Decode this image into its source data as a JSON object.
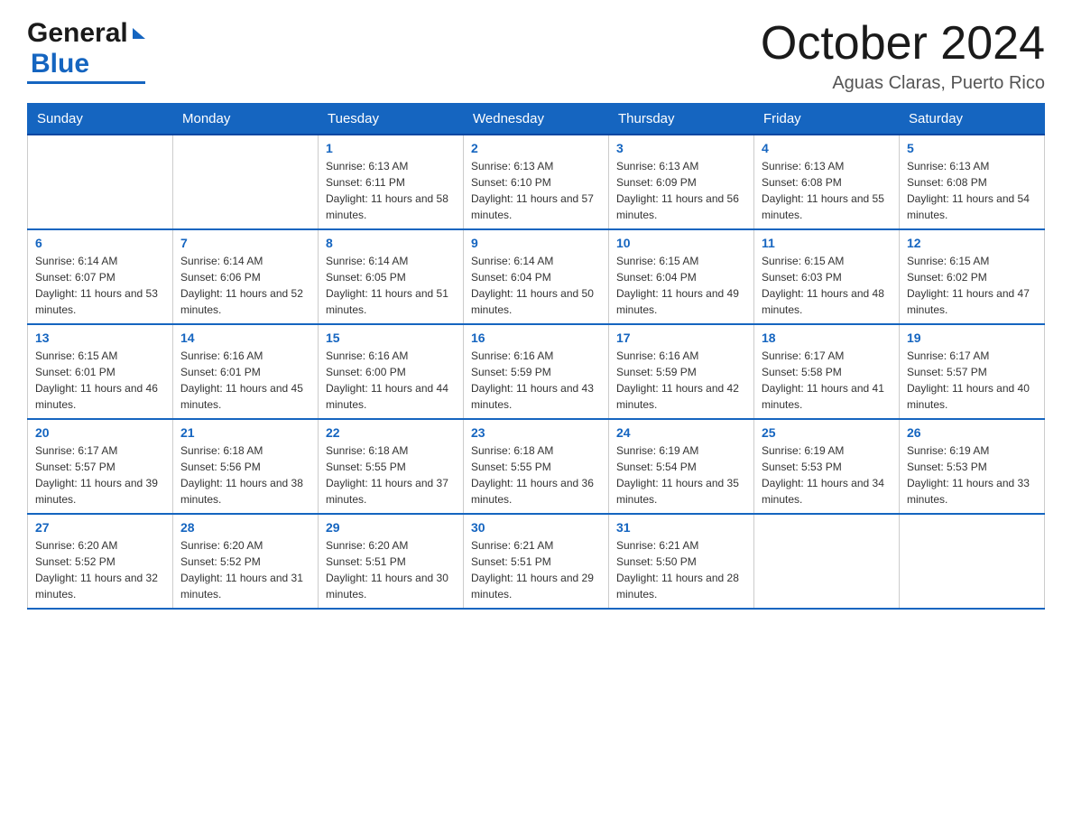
{
  "header": {
    "logo_general": "General",
    "logo_blue": "Blue",
    "month_title": "October 2024",
    "location": "Aguas Claras, Puerto Rico"
  },
  "days_of_week": [
    "Sunday",
    "Monday",
    "Tuesday",
    "Wednesday",
    "Thursday",
    "Friday",
    "Saturday"
  ],
  "weeks": [
    [
      {
        "day": "",
        "sunrise": "",
        "sunset": "",
        "daylight": ""
      },
      {
        "day": "",
        "sunrise": "",
        "sunset": "",
        "daylight": ""
      },
      {
        "day": "1",
        "sunrise": "Sunrise: 6:13 AM",
        "sunset": "Sunset: 6:11 PM",
        "daylight": "Daylight: 11 hours and 58 minutes."
      },
      {
        "day": "2",
        "sunrise": "Sunrise: 6:13 AM",
        "sunset": "Sunset: 6:10 PM",
        "daylight": "Daylight: 11 hours and 57 minutes."
      },
      {
        "day": "3",
        "sunrise": "Sunrise: 6:13 AM",
        "sunset": "Sunset: 6:09 PM",
        "daylight": "Daylight: 11 hours and 56 minutes."
      },
      {
        "day": "4",
        "sunrise": "Sunrise: 6:13 AM",
        "sunset": "Sunset: 6:08 PM",
        "daylight": "Daylight: 11 hours and 55 minutes."
      },
      {
        "day": "5",
        "sunrise": "Sunrise: 6:13 AM",
        "sunset": "Sunset: 6:08 PM",
        "daylight": "Daylight: 11 hours and 54 minutes."
      }
    ],
    [
      {
        "day": "6",
        "sunrise": "Sunrise: 6:14 AM",
        "sunset": "Sunset: 6:07 PM",
        "daylight": "Daylight: 11 hours and 53 minutes."
      },
      {
        "day": "7",
        "sunrise": "Sunrise: 6:14 AM",
        "sunset": "Sunset: 6:06 PM",
        "daylight": "Daylight: 11 hours and 52 minutes."
      },
      {
        "day": "8",
        "sunrise": "Sunrise: 6:14 AM",
        "sunset": "Sunset: 6:05 PM",
        "daylight": "Daylight: 11 hours and 51 minutes."
      },
      {
        "day": "9",
        "sunrise": "Sunrise: 6:14 AM",
        "sunset": "Sunset: 6:04 PM",
        "daylight": "Daylight: 11 hours and 50 minutes."
      },
      {
        "day": "10",
        "sunrise": "Sunrise: 6:15 AM",
        "sunset": "Sunset: 6:04 PM",
        "daylight": "Daylight: 11 hours and 49 minutes."
      },
      {
        "day": "11",
        "sunrise": "Sunrise: 6:15 AM",
        "sunset": "Sunset: 6:03 PM",
        "daylight": "Daylight: 11 hours and 48 minutes."
      },
      {
        "day": "12",
        "sunrise": "Sunrise: 6:15 AM",
        "sunset": "Sunset: 6:02 PM",
        "daylight": "Daylight: 11 hours and 47 minutes."
      }
    ],
    [
      {
        "day": "13",
        "sunrise": "Sunrise: 6:15 AM",
        "sunset": "Sunset: 6:01 PM",
        "daylight": "Daylight: 11 hours and 46 minutes."
      },
      {
        "day": "14",
        "sunrise": "Sunrise: 6:16 AM",
        "sunset": "Sunset: 6:01 PM",
        "daylight": "Daylight: 11 hours and 45 minutes."
      },
      {
        "day": "15",
        "sunrise": "Sunrise: 6:16 AM",
        "sunset": "Sunset: 6:00 PM",
        "daylight": "Daylight: 11 hours and 44 minutes."
      },
      {
        "day": "16",
        "sunrise": "Sunrise: 6:16 AM",
        "sunset": "Sunset: 5:59 PM",
        "daylight": "Daylight: 11 hours and 43 minutes."
      },
      {
        "day": "17",
        "sunrise": "Sunrise: 6:16 AM",
        "sunset": "Sunset: 5:59 PM",
        "daylight": "Daylight: 11 hours and 42 minutes."
      },
      {
        "day": "18",
        "sunrise": "Sunrise: 6:17 AM",
        "sunset": "Sunset: 5:58 PM",
        "daylight": "Daylight: 11 hours and 41 minutes."
      },
      {
        "day": "19",
        "sunrise": "Sunrise: 6:17 AM",
        "sunset": "Sunset: 5:57 PM",
        "daylight": "Daylight: 11 hours and 40 minutes."
      }
    ],
    [
      {
        "day": "20",
        "sunrise": "Sunrise: 6:17 AM",
        "sunset": "Sunset: 5:57 PM",
        "daylight": "Daylight: 11 hours and 39 minutes."
      },
      {
        "day": "21",
        "sunrise": "Sunrise: 6:18 AM",
        "sunset": "Sunset: 5:56 PM",
        "daylight": "Daylight: 11 hours and 38 minutes."
      },
      {
        "day": "22",
        "sunrise": "Sunrise: 6:18 AM",
        "sunset": "Sunset: 5:55 PM",
        "daylight": "Daylight: 11 hours and 37 minutes."
      },
      {
        "day": "23",
        "sunrise": "Sunrise: 6:18 AM",
        "sunset": "Sunset: 5:55 PM",
        "daylight": "Daylight: 11 hours and 36 minutes."
      },
      {
        "day": "24",
        "sunrise": "Sunrise: 6:19 AM",
        "sunset": "Sunset: 5:54 PM",
        "daylight": "Daylight: 11 hours and 35 minutes."
      },
      {
        "day": "25",
        "sunrise": "Sunrise: 6:19 AM",
        "sunset": "Sunset: 5:53 PM",
        "daylight": "Daylight: 11 hours and 34 minutes."
      },
      {
        "day": "26",
        "sunrise": "Sunrise: 6:19 AM",
        "sunset": "Sunset: 5:53 PM",
        "daylight": "Daylight: 11 hours and 33 minutes."
      }
    ],
    [
      {
        "day": "27",
        "sunrise": "Sunrise: 6:20 AM",
        "sunset": "Sunset: 5:52 PM",
        "daylight": "Daylight: 11 hours and 32 minutes."
      },
      {
        "day": "28",
        "sunrise": "Sunrise: 6:20 AM",
        "sunset": "Sunset: 5:52 PM",
        "daylight": "Daylight: 11 hours and 31 minutes."
      },
      {
        "day": "29",
        "sunrise": "Sunrise: 6:20 AM",
        "sunset": "Sunset: 5:51 PM",
        "daylight": "Daylight: 11 hours and 30 minutes."
      },
      {
        "day": "30",
        "sunrise": "Sunrise: 6:21 AM",
        "sunset": "Sunset: 5:51 PM",
        "daylight": "Daylight: 11 hours and 29 minutes."
      },
      {
        "day": "31",
        "sunrise": "Sunrise: 6:21 AM",
        "sunset": "Sunset: 5:50 PM",
        "daylight": "Daylight: 11 hours and 28 minutes."
      },
      {
        "day": "",
        "sunrise": "",
        "sunset": "",
        "daylight": ""
      },
      {
        "day": "",
        "sunrise": "",
        "sunset": "",
        "daylight": ""
      }
    ]
  ]
}
